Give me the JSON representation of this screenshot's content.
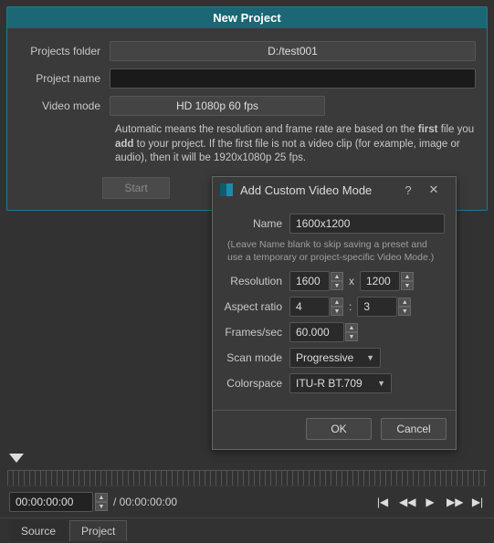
{
  "panel": {
    "title": "New Project",
    "folder_label": "Projects folder",
    "folder_value": "D:/test001",
    "name_label": "Project name",
    "name_value": "",
    "mode_label": "Video mode",
    "mode_value": "HD 1080p 60 fps",
    "help_html_prefix": "Automatic means the resolution and frame rate are based on the ",
    "help_bold1": "first",
    "help_mid": " file you ",
    "help_bold2": "add",
    "help_suffix": " to your project. If the first file is not a video clip (for example, image or audio), then it will be 1920x1080p 25 fps.",
    "start_label": "Start"
  },
  "dialog": {
    "title": "Add Custom Video Mode",
    "name_label": "Name",
    "name_value": "1600x1200",
    "hint": "(Leave Name blank to skip saving a preset and use a temporary or project-specific Video Mode.)",
    "res_label": "Resolution",
    "res_w": "1600",
    "res_h": "1200",
    "aspect_label": "Aspect ratio",
    "aspect_a": "4",
    "aspect_b": "3",
    "fps_label": "Frames/sec",
    "fps_value": "60.000",
    "scan_label": "Scan mode",
    "scan_value": "Progressive",
    "cs_label": "Colorspace",
    "cs_value": "ITU-R BT.709",
    "ok": "OK",
    "cancel": "Cancel"
  },
  "timeline": {
    "tc_current": "00:00:00:00",
    "tc_total": "/ 00:00:00:00",
    "tab_source": "Source",
    "tab_project": "Project"
  }
}
